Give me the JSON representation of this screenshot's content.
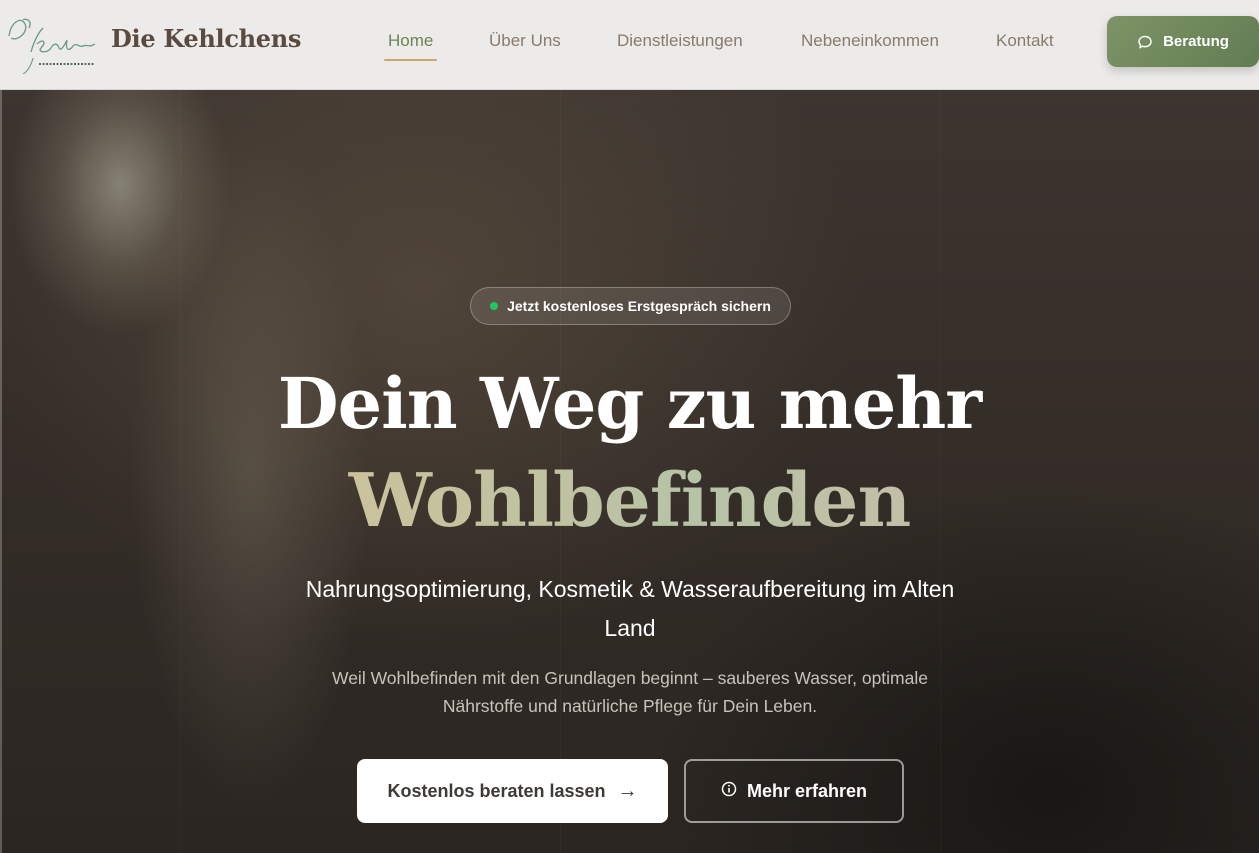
{
  "brand": {
    "name": "Die Kehlchens",
    "logo_alt": "Die Kehlchens",
    "logo_tagline": "Für mehr Energie und persönliches Wohlbefinden"
  },
  "nav": {
    "items": [
      {
        "label": "Home",
        "active": true
      },
      {
        "label": "Über Uns",
        "active": false
      },
      {
        "label": "Dienstleistungen",
        "active": false
      },
      {
        "label": "Nebeneinkommen",
        "active": false
      },
      {
        "label": "Kontakt",
        "active": false
      }
    ],
    "cta_label": "Beratung",
    "cta_icon": "chat-bubble-icon"
  },
  "hero": {
    "badge": "Jetzt kostenloses Erstgespräch sichern",
    "headline_line1": "Dein Weg zu mehr",
    "headline_line2": "Wohlbefinden",
    "subheadline": "Nahrungsoptimierung, Kosmetik & Wasseraufbereitung im Alten Land",
    "description": "Weil Wohlbefinden mit den Grundlagen beginnt – sauberes Wasser, optimale Nährstoffe und natürliche Pflege für Dein Leben.",
    "primary_button": "Kostenlos beraten lassen",
    "primary_button_icon": "arrow-right-icon",
    "secondary_button": "Mehr erfahren",
    "secondary_button_icon": "info-circle-icon"
  },
  "colors": {
    "accent_green": "#6b8554",
    "button_green": "#7d9466",
    "nav_underline_gold": "#c8a86a",
    "badge_dot_green": "#22c55e",
    "brand_brown": "#5a4a40"
  }
}
